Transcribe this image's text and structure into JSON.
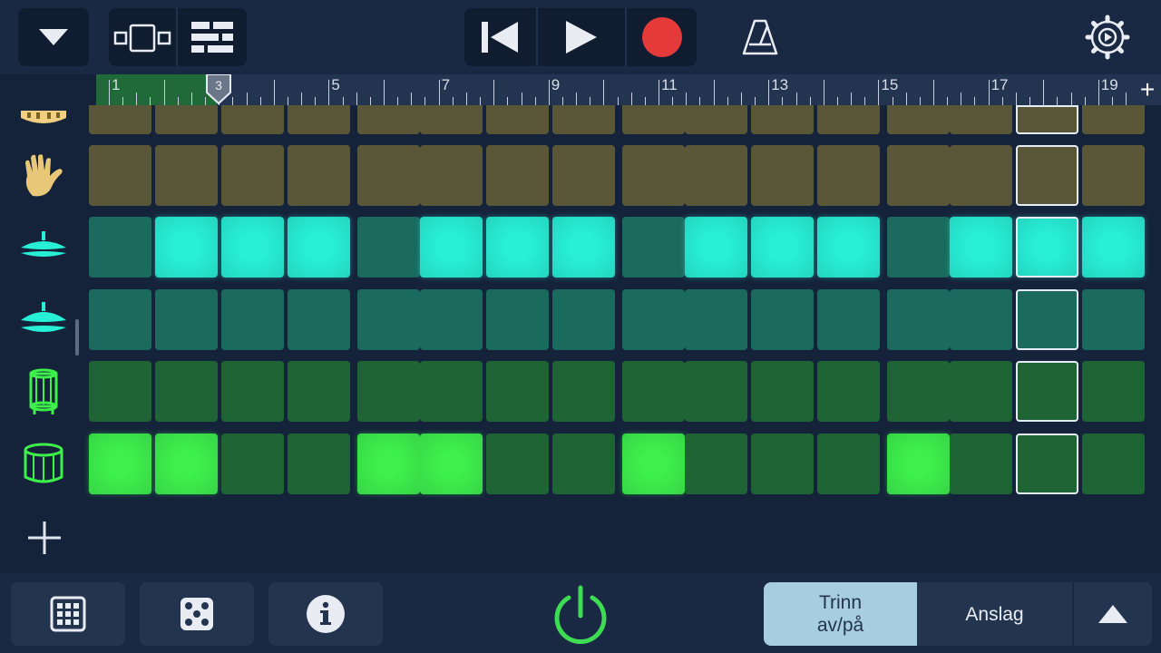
{
  "toolbar": {
    "icons": [
      "chevron-down-icon",
      "track-view-icon",
      "tracks-list-icon",
      "rewind-icon",
      "play-icon",
      "record-icon",
      "metronome-icon",
      "settings-icon"
    ],
    "record_color": "#e53a3a"
  },
  "ruler": {
    "labels": [
      "1",
      "3",
      "5",
      "7",
      "9",
      "11",
      "13",
      "15",
      "17",
      "19"
    ],
    "playhead_bar": "3",
    "add_label": "+"
  },
  "rows": [
    {
      "instrument": "tambourine",
      "icon": "tambourine-icon",
      "color_off": "#5a5638",
      "color_on": "#5a5638",
      "steps": [
        0,
        0,
        0,
        0,
        0,
        0,
        0,
        0,
        0,
        0,
        0,
        0,
        0,
        0,
        0,
        0
      ]
    },
    {
      "instrument": "hand-clap",
      "icon": "hand-clap-icon",
      "color_off": "#5a5638",
      "color_on": "#5a5638",
      "steps": [
        0,
        0,
        0,
        0,
        0,
        0,
        0,
        0,
        0,
        0,
        0,
        0,
        0,
        0,
        0,
        0
      ]
    },
    {
      "instrument": "closed-hi-hat",
      "icon": "hi-hat-icon",
      "color_off": "#1a6a5e",
      "color_on": "#27f0d6",
      "steps": [
        0,
        1,
        1,
        1,
        0,
        1,
        1,
        1,
        0,
        1,
        1,
        1,
        0,
        1,
        1,
        1
      ]
    },
    {
      "instrument": "open-hi-hat",
      "icon": "open-hi-hat-icon",
      "color_off": "#1a6a5e",
      "color_on": "#27f0d6",
      "steps": [
        0,
        0,
        0,
        0,
        0,
        0,
        0,
        0,
        0,
        0,
        0,
        0,
        0,
        0,
        0,
        0
      ]
    },
    {
      "instrument": "snare",
      "icon": "snare-drum-icon",
      "color_off": "#1e6434",
      "color_on": "#3df04a",
      "steps": [
        0,
        0,
        0,
        0,
        0,
        0,
        0,
        0,
        0,
        0,
        0,
        0,
        0,
        0,
        0,
        0
      ]
    },
    {
      "instrument": "kick",
      "icon": "kick-drum-icon",
      "color_off": "#1e6434",
      "color_on": "#3df04a",
      "steps": [
        1,
        1,
        0,
        0,
        1,
        1,
        0,
        0,
        1,
        0,
        0,
        0,
        1,
        0,
        0,
        0
      ]
    }
  ],
  "current_step": 14,
  "add_row_label": "+",
  "bottom": {
    "icons": [
      "grid-icon",
      "dice-icon",
      "info-icon",
      "power-icon",
      "arrow-up-icon"
    ],
    "segment": {
      "step_toggle": "Trinn\nav/på",
      "velocity": "Anslag",
      "active": "step_toggle"
    },
    "power_color": "#3ddc52"
  }
}
